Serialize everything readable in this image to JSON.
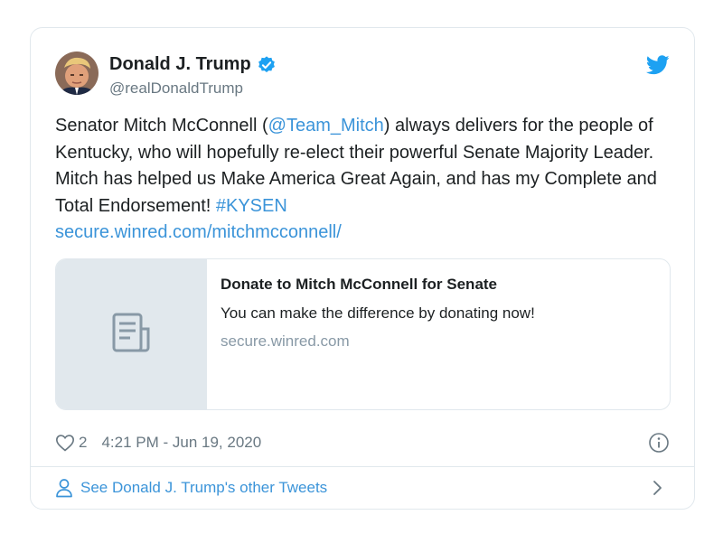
{
  "colors": {
    "link": "#3b94d9",
    "text": "#1c2022",
    "muted": "#697882",
    "border": "#e1e8ed",
    "verified": "#1da1f2"
  },
  "author": {
    "name": "Donald J. Trump",
    "handle": "@realDonaldTrump",
    "verified": true,
    "avatar_icon": "profile-photo"
  },
  "tweet": {
    "text_part1": "Senator Mitch McConnell (",
    "mention": "@Team_Mitch",
    "text_part2": ") always delivers for the people of Kentucky, who will hopefully re-elect their powerful Senate Majority Leader. Mitch has helped us Make America Great Again, and has my Complete and Total Endorsement! ",
    "hashtag": "#KYSEN",
    "link": "secure.winred.com/mitchmcconnell/"
  },
  "link_preview": {
    "title": "Donate to Mitch McConnell for Senate",
    "description": "You can make the difference by donating now!",
    "domain": "secure.winred.com",
    "thumb_icon": "document-icon"
  },
  "meta": {
    "like_count": "2",
    "timestamp": "4:21 PM - Jun 19, 2020"
  },
  "footer": {
    "label": "See Donald J. Trump's other Tweets"
  }
}
